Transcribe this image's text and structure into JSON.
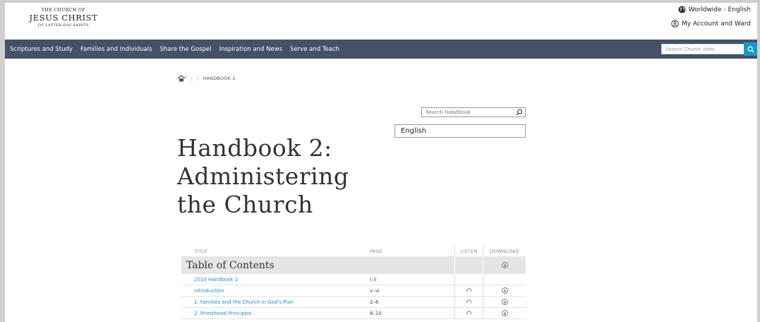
{
  "logo": {
    "line1": "THE CHURCH OF",
    "line2": "JESUS CHRIST",
    "line3": "OF LATTER-DAY SAINTS"
  },
  "utility": {
    "language": "Worldwide - English",
    "account": "My Account and Ward"
  },
  "nav": {
    "items": [
      {
        "label": "Scriptures and Study"
      },
      {
        "label": "Families and Individuals"
      },
      {
        "label": "Share the Gospel"
      },
      {
        "label": "Inspiration and News"
      },
      {
        "label": "Serve and Teach"
      }
    ],
    "search_placeholder": "Search Church sites"
  },
  "breadcrumb": {
    "current": "HANDBOOK 2"
  },
  "handbook_search": {
    "placeholder": "Search Handbook"
  },
  "language_select": {
    "value": "English"
  },
  "title": {
    "line1": "Handbook 2:",
    "line2": "Administering",
    "line3": "the Church"
  },
  "table": {
    "headers": {
      "title": "TITLE",
      "page": "PAGE",
      "listen": "LISTEN",
      "download": "DOWNLOAD"
    },
    "section": "Table of Contents",
    "rows": [
      {
        "title": "2010 Handbook 2",
        "page": "i–ii",
        "listen": false,
        "download": false
      },
      {
        "title": "Introduction",
        "page": "v–vi",
        "listen": true,
        "download": true
      },
      {
        "title": "1. Families and the Church in God's Plan",
        "page": "2–6",
        "listen": true,
        "download": true
      },
      {
        "title": "2. Priesthood Principles",
        "page": "8–10",
        "listen": true,
        "download": true
      }
    ]
  },
  "colors": {
    "nav_bg": "#445166",
    "accent": "#1a97cf",
    "link": "#1f8fc1"
  }
}
